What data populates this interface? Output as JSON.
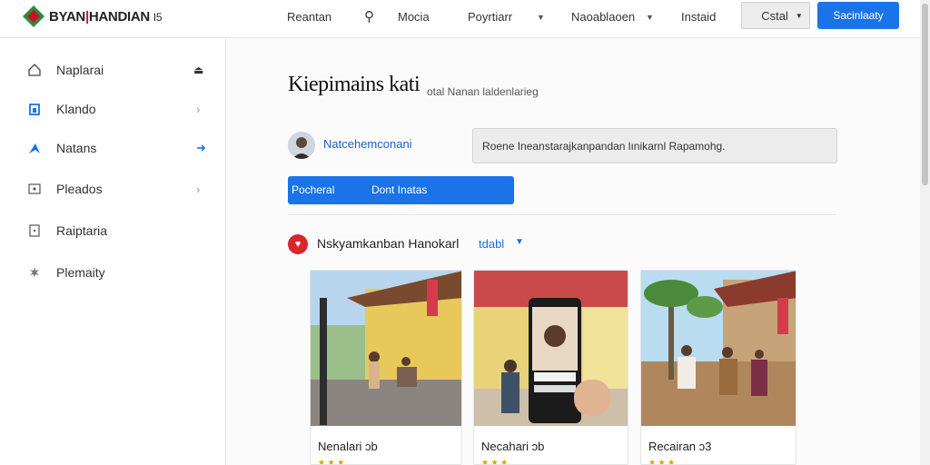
{
  "header": {
    "logo_text_left": "BYAN",
    "logo_text_right": "HANDIAN",
    "logo_suffix": "I5",
    "nav": [
      {
        "label": "Reantan"
      },
      {
        "label": "Mocia"
      },
      {
        "label": "Poyrtiarr"
      },
      {
        "label": "Naoablaoen"
      },
      {
        "label": "Instaid"
      }
    ],
    "cstal_label": "Cstal",
    "primary_label": "Sacinlaaty"
  },
  "sidebar": {
    "items": [
      {
        "label": "Naplarai",
        "icon": "home-icon"
      },
      {
        "label": "Klando",
        "icon": "bookmark-icon"
      },
      {
        "label": "Natans",
        "icon": "send-icon"
      },
      {
        "label": "Pleados",
        "icon": "image-icon"
      },
      {
        "label": "Raiptaria",
        "icon": "calendar-icon"
      },
      {
        "label": "Plemaity",
        "icon": "settings-icon"
      }
    ]
  },
  "main": {
    "title": "Kiepimains kati",
    "subtitle": "otal Nanan laldenlarieg",
    "user_name": "Natcehemconani",
    "message_value": "Roene Ineanstarajkanpandan lınikarnl Rapamohg.",
    "tabs": [
      {
        "label": "Pocheral"
      },
      {
        "label": "Dont Inatas"
      }
    ],
    "section_title": "Nskyamkanban Hanokarl",
    "section_link": "tdabl",
    "cards": [
      {
        "label": "Nenalari ɔb"
      },
      {
        "label": "Necahari ɔb"
      },
      {
        "label": "Recairan ɔ3"
      }
    ]
  },
  "colors": {
    "accent": "#1a73e8",
    "brand_red": "#c8102e",
    "heart_red": "#d9252b"
  }
}
